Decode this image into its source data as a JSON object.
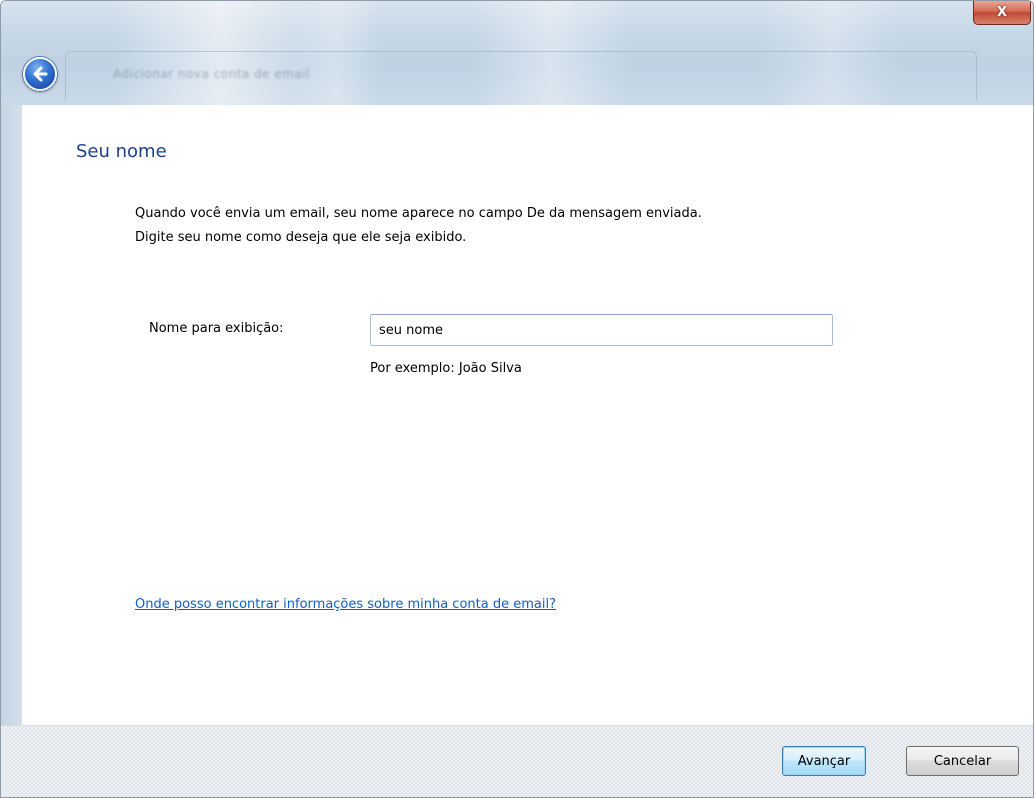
{
  "window": {
    "title": "Adicionar nova conta de email",
    "close_label": "X"
  },
  "page": {
    "heading": "Seu nome",
    "description_line1": "Quando você envia um email, seu nome aparece no campo De da mensagem enviada.",
    "description_line2": "Digite seu nome como deseja que ele seja exibido."
  },
  "form": {
    "display_name_label": "Nome para exibição:",
    "display_name_value": "seu nome",
    "example_text": "Por exemplo: João Silva"
  },
  "help_link": "Onde posso encontrar informações sobre minha conta de email?",
  "buttons": {
    "next_label": "Avançar",
    "cancel_label": "Cancelar"
  },
  "icons": {
    "back": "back-arrow-icon",
    "close": "close-icon"
  },
  "colors": {
    "heading": "#1e3f8a",
    "link": "#0f5fc6",
    "close_button": "#c04a36",
    "back_button": "#2f6fd0"
  }
}
